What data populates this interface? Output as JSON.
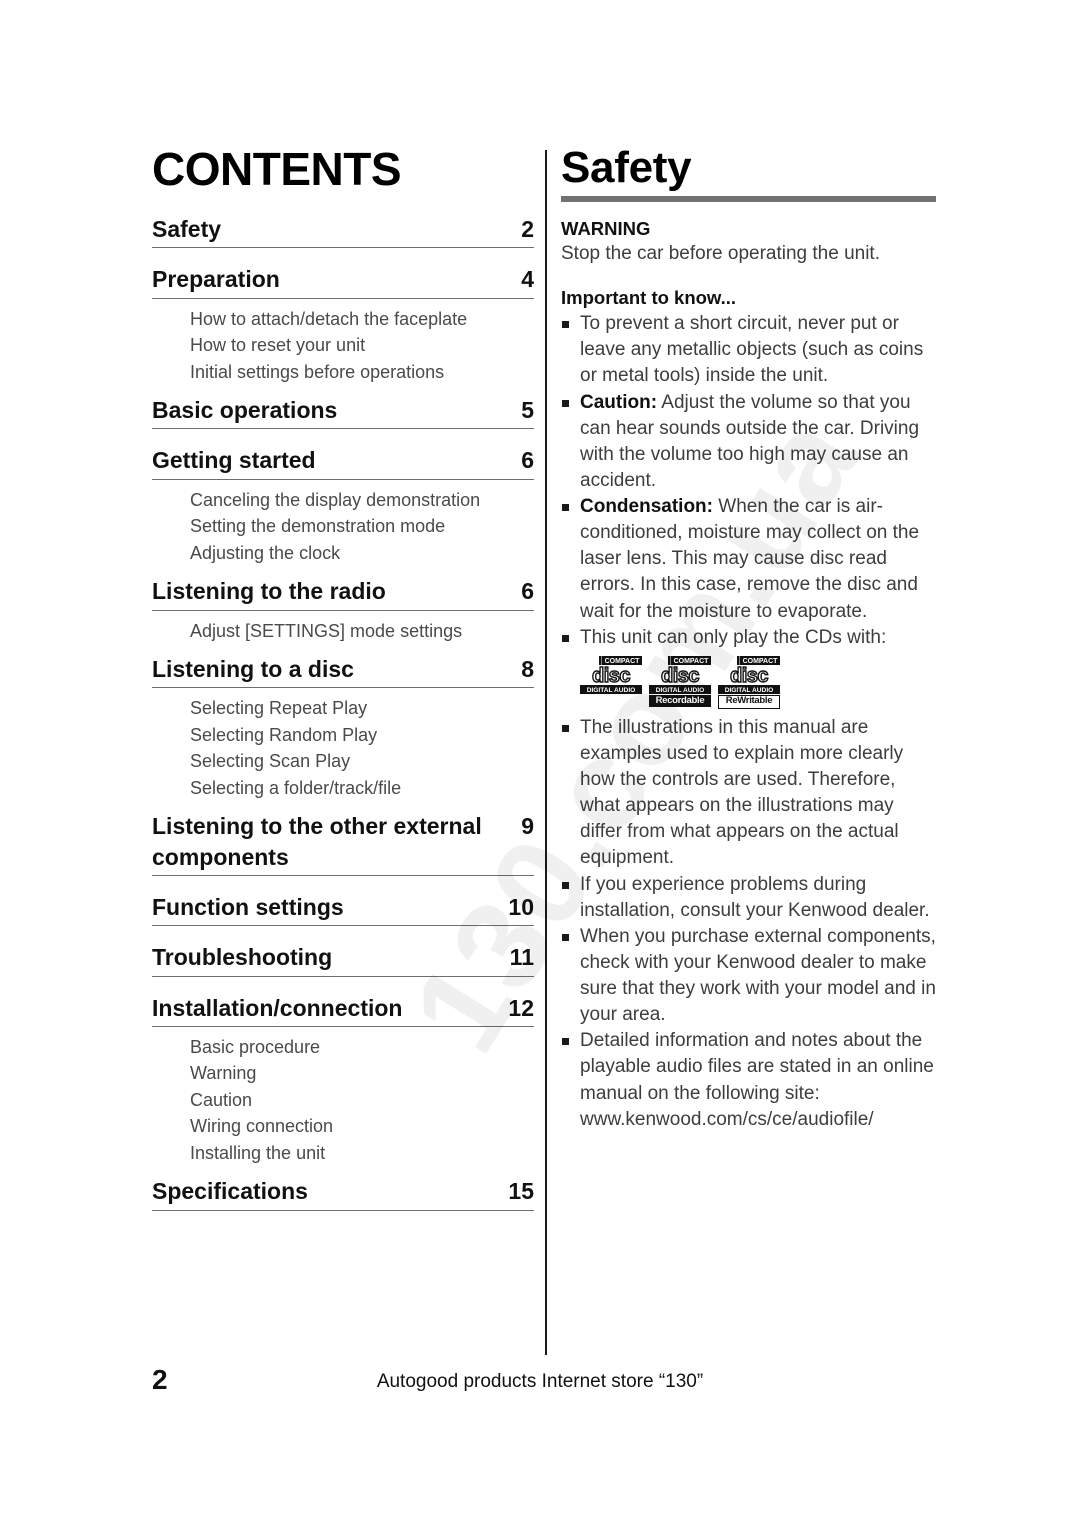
{
  "watermark": "130.com.ua",
  "contents": {
    "title": "CONTENTS",
    "entries": [
      {
        "label": "Safety",
        "page": "2",
        "sub": []
      },
      {
        "label": "Preparation",
        "page": "4",
        "sub": [
          "How to attach/detach the faceplate",
          "How to reset your unit",
          "Initial settings before operations"
        ]
      },
      {
        "label": "Basic operations",
        "page": "5",
        "sub": []
      },
      {
        "label": "Getting started",
        "page": "6",
        "sub": [
          "Canceling the display demonstration",
          "Setting the demonstration mode",
          "Adjusting the clock"
        ]
      },
      {
        "label": "Listening to the radio",
        "page": "6",
        "sub": [
          "Adjust [SETTINGS] mode settings"
        ]
      },
      {
        "label": "Listening to a disc",
        "page": "8",
        "sub": [
          "Selecting Repeat Play",
          "Selecting Random Play",
          "Selecting Scan Play",
          "Selecting a folder/track/file"
        ]
      },
      {
        "label": "Listening to the other external components",
        "page": "9",
        "sub": []
      },
      {
        "label": "Function settings",
        "page": "10",
        "sub": []
      },
      {
        "label": "Troubleshooting",
        "page": "11",
        "sub": []
      },
      {
        "label": "Installation/connection",
        "page": "12",
        "sub": [
          "Basic procedure",
          "Warning",
          "Caution",
          "Wiring connection",
          "Installing the unit"
        ]
      },
      {
        "label": "Specifications",
        "page": "15",
        "sub": []
      }
    ]
  },
  "safety": {
    "title": "Safety",
    "warning_head": "WARNING",
    "warning_text": "Stop the car before operating the unit.",
    "important_head": "Important to know...",
    "bullets": [
      {
        "bold": "",
        "text": "To prevent a short circuit, never put or leave any metallic objects (such as coins or metal tools) inside the unit."
      },
      {
        "bold": "Caution:",
        "text": " Adjust the volume so that you can hear sounds outside the car. Driving with the volume too high may cause an accident."
      },
      {
        "bold": "Condensation:",
        "text": " When the car is air-conditioned, moisture may collect on the laser lens. This may cause disc read errors. In this case, remove the disc and wait for the moisture to evaporate."
      },
      {
        "bold": "",
        "text": "This unit can only play the CDs with:"
      }
    ],
    "cd_logos": [
      {
        "top": "COMPACT",
        "mid": "disc",
        "bottom": "DIGITAL AUDIO",
        "band": "",
        "band_style": "none"
      },
      {
        "top": "COMPACT",
        "mid": "disc",
        "bottom": "DIGITAL AUDIO",
        "band": "Recordable",
        "band_style": "filled"
      },
      {
        "top": "COMPACT",
        "mid": "disc",
        "bottom": "DIGITAL AUDIO",
        "band": "ReWritable",
        "band_style": "outlined"
      }
    ],
    "bullets_after": [
      {
        "bold": "",
        "text": "The illustrations in this manual are examples used to explain more clearly how the controls are used. Therefore, what appears on the illustrations may differ from what appears on the actual equipment."
      },
      {
        "bold": "",
        "text": "If you experience problems during installation, consult your Kenwood dealer."
      },
      {
        "bold": "",
        "text": "When you purchase external components, check with your Kenwood dealer to make sure that they work with your model and in your area."
      },
      {
        "bold": "",
        "text": "Detailed information and notes about the playable audio files are stated in an online manual on the following site: www.kenwood.com/cs/ce/audiofile/"
      }
    ]
  },
  "footer": {
    "page_number": "2",
    "note": "Autogood products Internet store “130”"
  }
}
